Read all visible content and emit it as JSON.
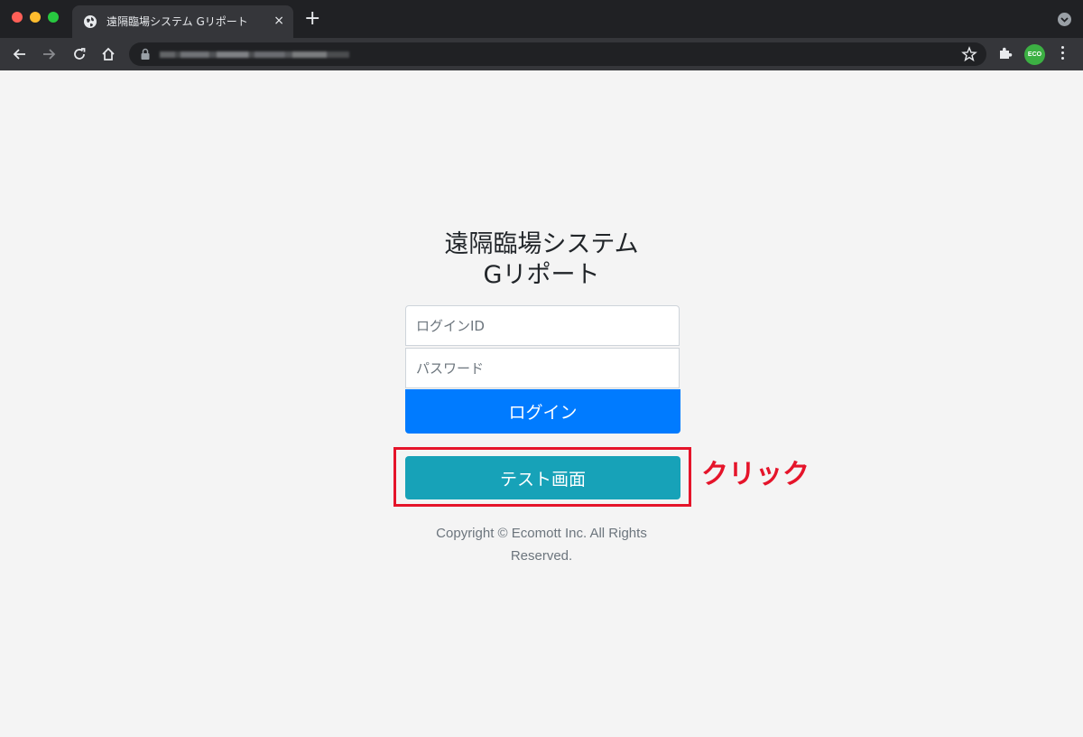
{
  "browser": {
    "tab_title": "遠隔臨場システム Gリポート",
    "tab_close_glyph": "×",
    "new_tab_glyph": "+",
    "extension_badge": "ECO"
  },
  "login": {
    "title_line1": "遠隔臨場システム",
    "title_line2": "Gリポート",
    "login_id_placeholder": "ログインID",
    "password_placeholder": "パスワード",
    "login_button": "ログイン",
    "test_button": "テスト画面",
    "annotation": "クリック",
    "copyright": "Copyright © Ecomott Inc. All Rights Reserved."
  },
  "colors": {
    "primary": "#007bff",
    "info": "#17a2b8",
    "annotation_red": "#e5142a"
  }
}
